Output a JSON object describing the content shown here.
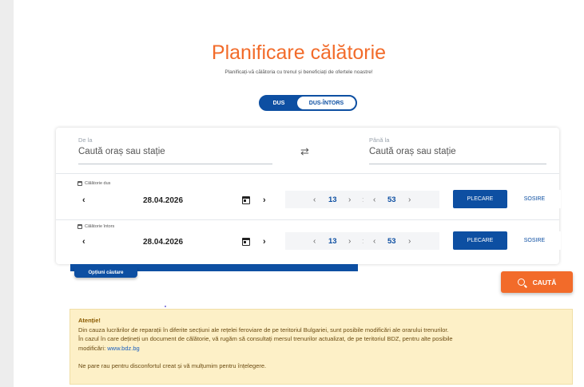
{
  "header": {
    "title": "Planificare călătorie",
    "subtitle": "Planificați-vă călătoria cu trenul și beneficiați de ofertele noastre!"
  },
  "trip_type": {
    "options": [
      "DUS",
      "DUS-ÎNTORS"
    ],
    "selected": "DUS-ÎNTORS"
  },
  "route": {
    "from_label": "De la",
    "from_placeholder": "Caută oraș sau stație",
    "to_label": "Până la",
    "to_placeholder": "Caută oraș sau stație",
    "swap_icon": "swap-arrows-icon"
  },
  "outbound": {
    "label": "Călătorie dus",
    "date": "28.04.2026",
    "hour": "13",
    "minute": "53",
    "departure_label": "PLECARE",
    "arrival_label": "SOSIRE",
    "selected_mode": "PLECARE"
  },
  "return": {
    "label": "Călătorie întors",
    "date": "28.04.2026",
    "hour": "13",
    "minute": "53",
    "departure_label": "PLECARE",
    "arrival_label": "SOSIRE",
    "selected_mode": "PLECARE"
  },
  "options_button": "Opțiuni căutare",
  "search_button": "CAUTĂ",
  "alert": {
    "title": "Atenție!",
    "line1": "Din cauza lucrărilor de reparații în diferite secțiuni ale rețelei feroviare de pe teritoriul Bulgariei, sunt posibile modificări ale orarului trenurilor.",
    "line2": "În cazul în care dețineți un document de călătorie, vă rugăm să consultați mersul trenurilor actualizat, de pe teritoriul BDZ, pentru alte posibile",
    "line3_prefix": "modificări: ",
    "link": "www.bdz.bg",
    "line4": "Ne pare rau pentru disconfortul creat și vă mulțumim pentru înțelegere."
  },
  "colors": {
    "accent": "#f26b2a",
    "primary": "#0d4fa2",
    "alert_bg": "#fdf0c7"
  }
}
